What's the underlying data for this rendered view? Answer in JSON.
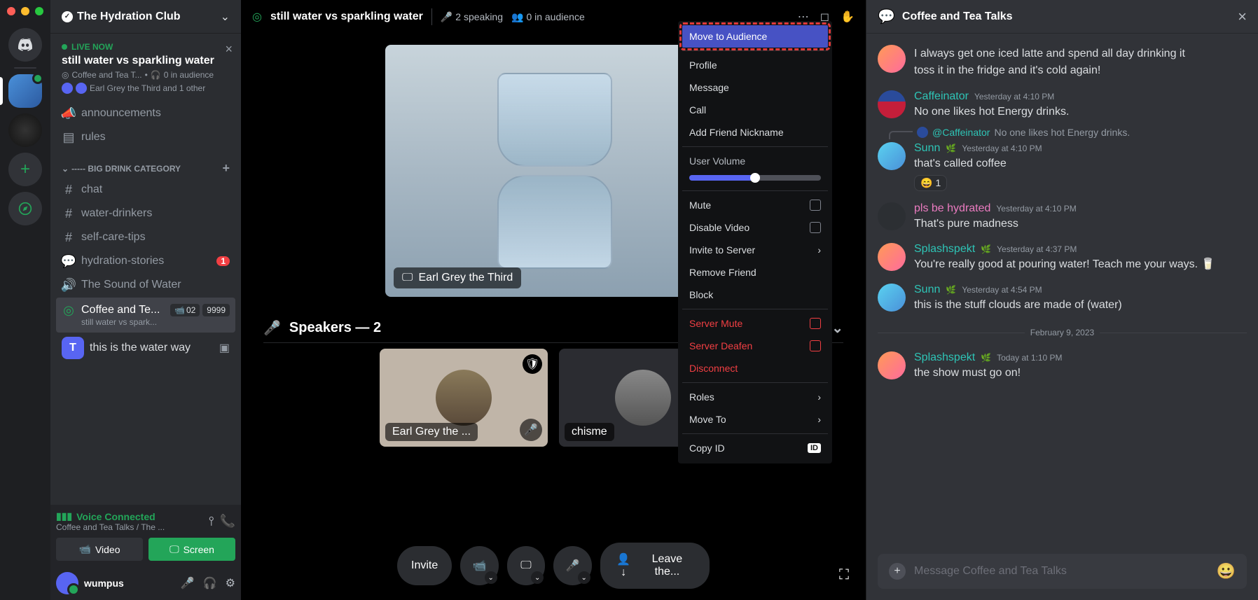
{
  "server": {
    "name": "The Hydration Club"
  },
  "live": {
    "label": "LIVE NOW",
    "title": "still water vs sparkling water",
    "channel": "Coffee and Tea T...",
    "audience": "0 in audience",
    "users": "Earl Grey the Third and 1 other"
  },
  "channels": {
    "announcements": "announcements",
    "rules": "rules",
    "category": "----- BIG DRINK CATEGORY",
    "chat": "chat",
    "water_drinkers": "water-drinkers",
    "self_care": "self-care-tips",
    "hydration_stories": "hydration-stories",
    "hydration_badge": "1",
    "sound": "The Sound of Water",
    "stage_name": "Coffee and Te...",
    "stage_sub": "still water vs spark...",
    "stage_pill1": "02",
    "stage_pill2": "9999",
    "user_t": "this is the water way"
  },
  "voice": {
    "status": "Voice Connected",
    "sub": "Coffee and Tea Talks / The ...",
    "video": "Video",
    "screen": "Screen"
  },
  "me": {
    "name": "wumpus"
  },
  "stage": {
    "title": "still water vs sparkling water",
    "speaking": "2 speaking",
    "audience": "0 in audience",
    "video_name": "Earl Grey the Third",
    "speakers_hdr": "Speakers — 2",
    "speaker1": "Earl Grey the ...",
    "speaker2": "chisme",
    "invite": "Invite",
    "leave": "Leave the..."
  },
  "ctx": {
    "move_audience": "Move to Audience",
    "profile": "Profile",
    "message": "Message",
    "call": "Call",
    "nickname": "Add Friend Nickname",
    "volume": "User Volume",
    "mute": "Mute",
    "disable_video": "Disable Video",
    "invite_server": "Invite to Server",
    "remove_friend": "Remove Friend",
    "block": "Block",
    "server_mute": "Server Mute",
    "server_deafen": "Server Deafen",
    "disconnect": "Disconnect",
    "roles": "Roles",
    "move_to": "Move To",
    "copy_id": "Copy ID",
    "id_badge": "ID"
  },
  "chat": {
    "title": "Coffee and Tea Talks",
    "msg0_a": "I always get one iced latte and spend all day drinking it",
    "msg0_b": "toss it in the fridge and it's cold again!",
    "msg1_author": "Caffeinator",
    "msg1_time": "Yesterday at 4:10 PM",
    "msg1_text": "No one likes hot Energy drinks.",
    "reply_name": "@Caffeinator",
    "reply_text": "No one likes hot Energy drinks.",
    "msg2_author": "Sunn",
    "msg2_time": "Yesterday at 4:10 PM",
    "msg2_text": "that's called coffee",
    "react_count": "1",
    "msg3_author": "pls be hydrated",
    "msg3_time": "Yesterday at 4:10 PM",
    "msg3_text": "That's pure madness",
    "msg4_author": "Splashspekt",
    "msg4_time": "Yesterday at 4:37 PM",
    "msg4_text": "You're really good at pouring water! Teach me your ways. 🥛",
    "msg5_author": "Sunn",
    "msg5_time": "Yesterday at 4:54 PM",
    "msg5_text": "this is the stuff clouds are made of (water)",
    "date_div": "February 9, 2023",
    "msg6_author": "Splashspekt",
    "msg6_time": "Today at 1:10 PM",
    "msg6_text": "the show must go on!",
    "placeholder": "Message Coffee and Tea Talks"
  }
}
